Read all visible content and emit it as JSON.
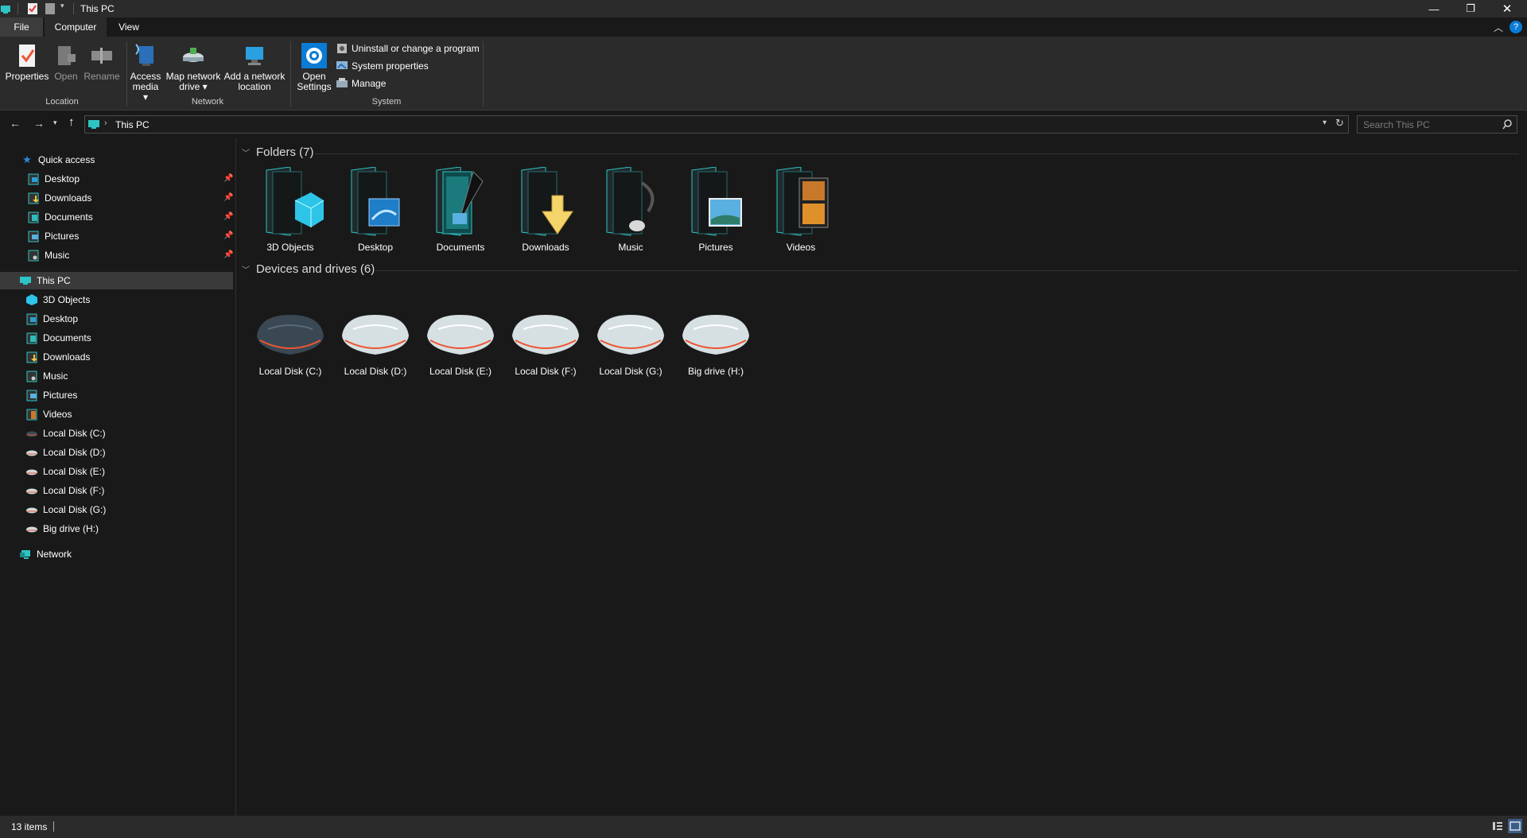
{
  "window": {
    "title": "This PC"
  },
  "ribbon": {
    "tabs": {
      "file": "File",
      "computer": "Computer",
      "view": "View"
    },
    "location": {
      "label": "Location",
      "properties": "Properties",
      "open": "Open",
      "rename": "Rename"
    },
    "network": {
      "label": "Network",
      "access_media_1": "Access",
      "access_media_2": "media",
      "map_drive_1": "Map network",
      "map_drive_2": "drive",
      "add_location_1": "Add a network",
      "add_location_2": "location"
    },
    "system": {
      "label": "System",
      "open_settings_1": "Open",
      "open_settings_2": "Settings",
      "uninstall": "Uninstall or change a program",
      "system_properties": "System properties",
      "manage": "Manage"
    }
  },
  "address": {
    "path": "This PC",
    "search_placeholder": "Search This PC"
  },
  "nav": {
    "quick_access": "Quick access",
    "quick_items": [
      "Desktop",
      "Downloads",
      "Documents",
      "Pictures",
      "Music"
    ],
    "this_pc": "This PC",
    "pc_items": [
      "3D Objects",
      "Desktop",
      "Documents",
      "Downloads",
      "Music",
      "Pictures",
      "Videos",
      "Local Disk (C:)",
      "Local Disk (D:)",
      "Local Disk (E:)",
      "Local Disk (F:)",
      "Local Disk (G:)",
      "Big drive (H:)"
    ],
    "network": "Network"
  },
  "content": {
    "folders_header": "Folders (7)",
    "folders": [
      "3D Objects",
      "Desktop",
      "Documents",
      "Downloads",
      "Music",
      "Pictures",
      "Videos"
    ],
    "drives_header": "Devices and drives (6)",
    "drives": [
      "Local Disk (C:)",
      "Local Disk (D:)",
      "Local Disk (E:)",
      "Local Disk (F:)",
      "Local Disk (G:)",
      "Big drive (H:)"
    ]
  },
  "status": {
    "items": "13 items"
  },
  "colors": {
    "background": "#191919",
    "chrome": "#2b2b2b",
    "selection": "#3a3a3a",
    "accent": "#0a7bd6",
    "teal": "#2ec4c4"
  }
}
